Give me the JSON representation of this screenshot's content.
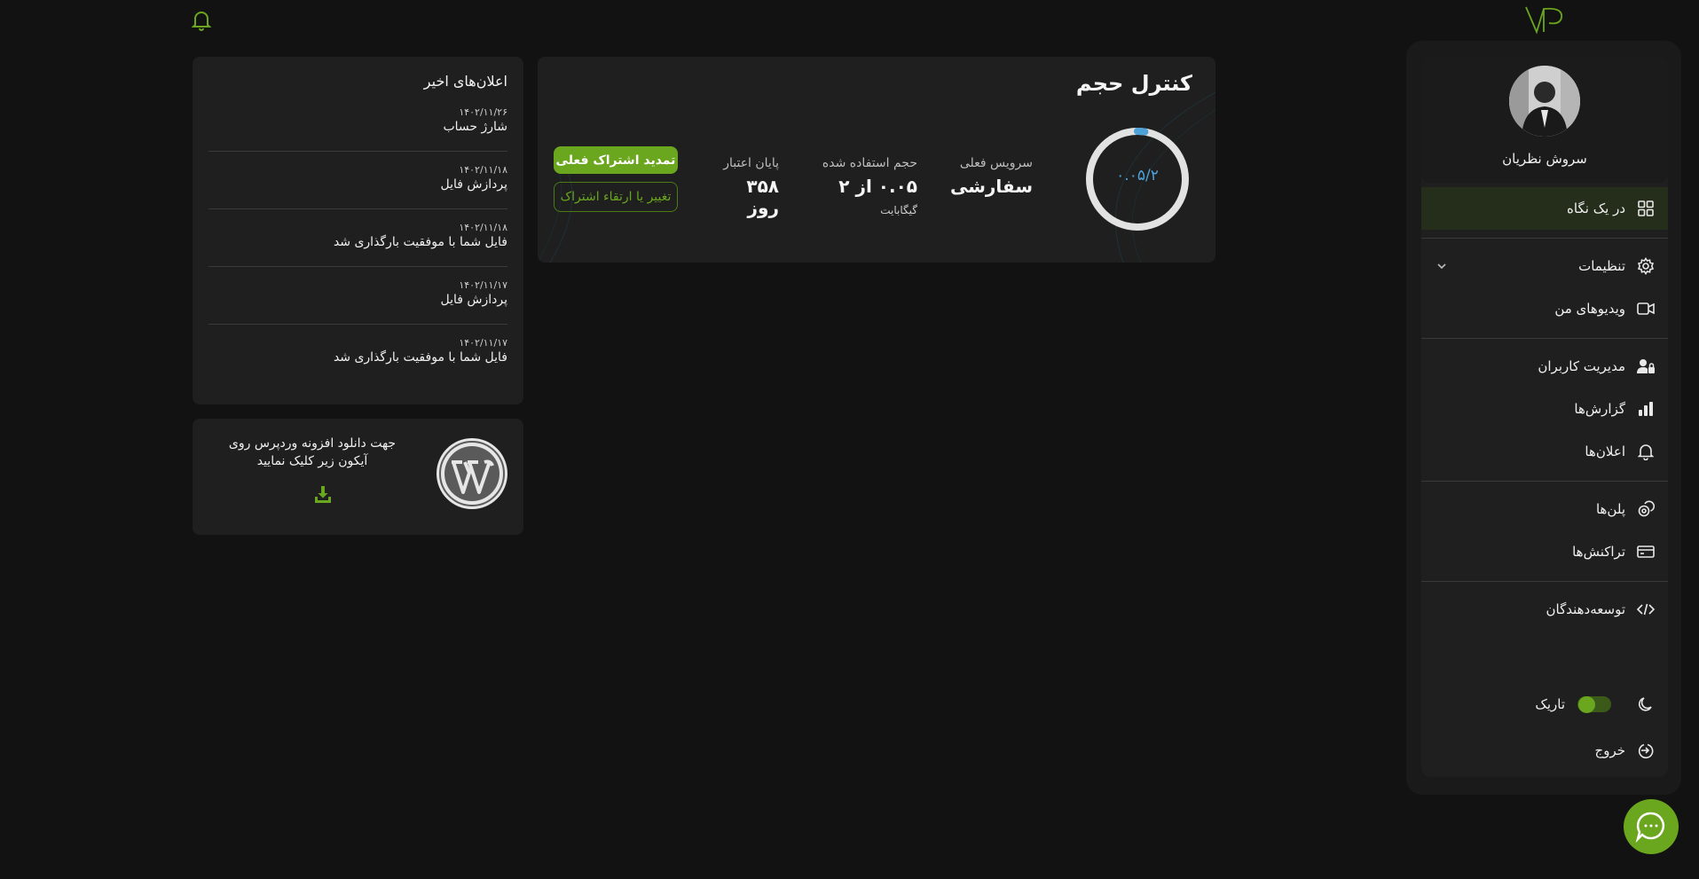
{
  "profile": {
    "name": "سروش نظریان"
  },
  "sidebar": {
    "items": [
      {
        "label": "در یک نگاه",
        "icon": "grid-icon"
      },
      {
        "label": "تنظیمات",
        "icon": "gear-icon"
      },
      {
        "label": "ویدیوهای من",
        "icon": "video-icon"
      },
      {
        "label": "مدیریت کاربران",
        "icon": "user-lock-icon"
      },
      {
        "label": "گزارش‌ها",
        "icon": "bar-chart-icon"
      },
      {
        "label": "اعلان‌ها",
        "icon": "bell-icon"
      },
      {
        "label": "پلن‌ها",
        "icon": "coins-icon"
      },
      {
        "label": "تراکنش‌ها",
        "icon": "credit-card-icon"
      },
      {
        "label": "توسعه‌دهندگان",
        "icon": "code-icon"
      }
    ],
    "theme_label": "تاریک",
    "logout_label": "خروج"
  },
  "volume": {
    "title": "کنترل حجم",
    "gauge_text": "۰.۰۵/۲",
    "usage_fraction": 0.025,
    "service_label": "سرویس فعلی",
    "service_value": "سفارشی",
    "used_label": "حجم استفاده شده",
    "used_value": "۰.۰۵ از ۲",
    "used_unit": "گیگابایت",
    "expiry_label": "پایان اعتبار",
    "expiry_value": "۳۵۸ روز",
    "renew_button": "تمدید اشتراک فعلی",
    "upgrade_button": "تغییر یا ارتقاء اشتراک"
  },
  "notifications": {
    "title": "اعلان‌های اخیر",
    "items": [
      {
        "date": "۱۴۰۲/۱۱/۲۶",
        "text": "شارژ حساب"
      },
      {
        "date": "۱۴۰۲/۱۱/۱۸",
        "text": "پردازش فایل"
      },
      {
        "date": "۱۴۰۲/۱۱/۱۸",
        "text": "فایل شما با موفقیت بارگذاری شد"
      },
      {
        "date": "۱۴۰۲/۱۱/۱۷",
        "text": "پردازش فایل"
      },
      {
        "date": "۱۴۰۲/۱۱/۱۷",
        "text": "فایل شما با موفقیت بارگذاری شد"
      }
    ]
  },
  "wordpress": {
    "line1": "جهت دانلود افزونه وردپرس روی",
    "line2": "آیکون زیر کلیک نمایید"
  },
  "colors": {
    "accent": "#6aa61e",
    "background": "#121212",
    "card": "#1f1f1f",
    "gauge_blue": "#4da2d8"
  }
}
